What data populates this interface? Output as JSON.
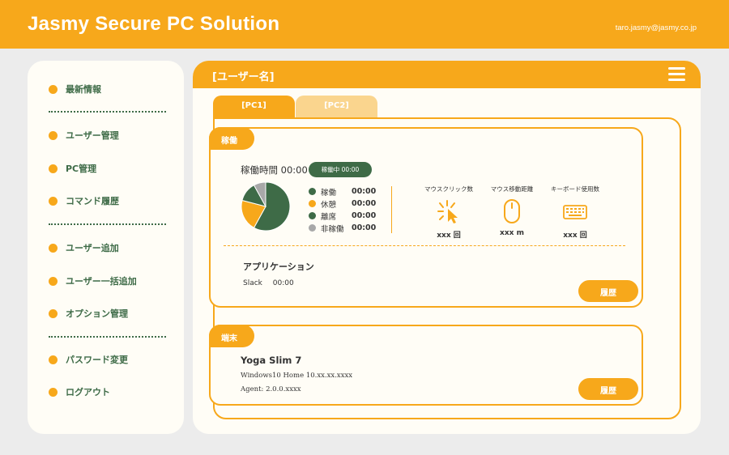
{
  "header": {
    "app_title": "Jasmy Secure PC Solution",
    "user_email": "taro.jasmy@jasmy.co.jp"
  },
  "colors": {
    "accent": "#f7a81b",
    "accent_light": "#fad58e",
    "green": "#3e6b47",
    "gray": "#a8a8a8",
    "background": "#ececec",
    "panel": "#fffdf6"
  },
  "sidebar": {
    "items": [
      {
        "label": "最新情報"
      },
      {
        "label": "ユーザー管理"
      },
      {
        "label": "PC管理"
      },
      {
        "label": "コマンド履歴"
      },
      {
        "label": "ユーザー追加"
      },
      {
        "label": "ユーザー一括追加"
      },
      {
        "label": "オプション管理"
      },
      {
        "label": "パスワード変更"
      },
      {
        "label": "ログアウト"
      }
    ]
  },
  "main": {
    "title": "[ユーザー名]",
    "menu_icon": "hamburger-menu-icon",
    "tabs": [
      {
        "label": "[PC1]",
        "active": true
      },
      {
        "label": "[PC2]",
        "active": false
      }
    ],
    "usage": {
      "tag": "稼働",
      "uptime_label": "稼働時間 00:00",
      "status_pill": "稼働中 00:00",
      "legend": [
        {
          "label": "稼働",
          "time": "00:00",
          "color": "#3e6b47",
          "share": 0.58
        },
        {
          "label": "休憩",
          "time": "00:00",
          "color": "#f7a81b",
          "share": 0.21
        },
        {
          "label": "離席",
          "time": "00:00",
          "color": "#3e6b47",
          "share": 0.13
        },
        {
          "label": "非稼働",
          "time": "00:00",
          "color": "#a8a8a8",
          "share": 0.08
        }
      ],
      "metrics": [
        {
          "title": "マウスクリック数",
          "value": "xxx 回",
          "icon": "mouse-click-icon"
        },
        {
          "title": "マウス移動距離",
          "value": "xxx m",
          "icon": "mouse-icon"
        },
        {
          "title": "キーボード使用数",
          "value": "xxx 回",
          "icon": "keyboard-icon"
        }
      ],
      "app_section_title": "アプリケーション",
      "apps": [
        {
          "name": "Slack",
          "time": "00:00"
        }
      ],
      "history_label": "履歴"
    },
    "device": {
      "tag": "端末",
      "name": "Yoga Slim 7",
      "os": "Windows10 Home 10.xx.xx.xxxx",
      "agent": "Agent: 2.0.0.xxxx",
      "history_label": "履歴"
    }
  }
}
